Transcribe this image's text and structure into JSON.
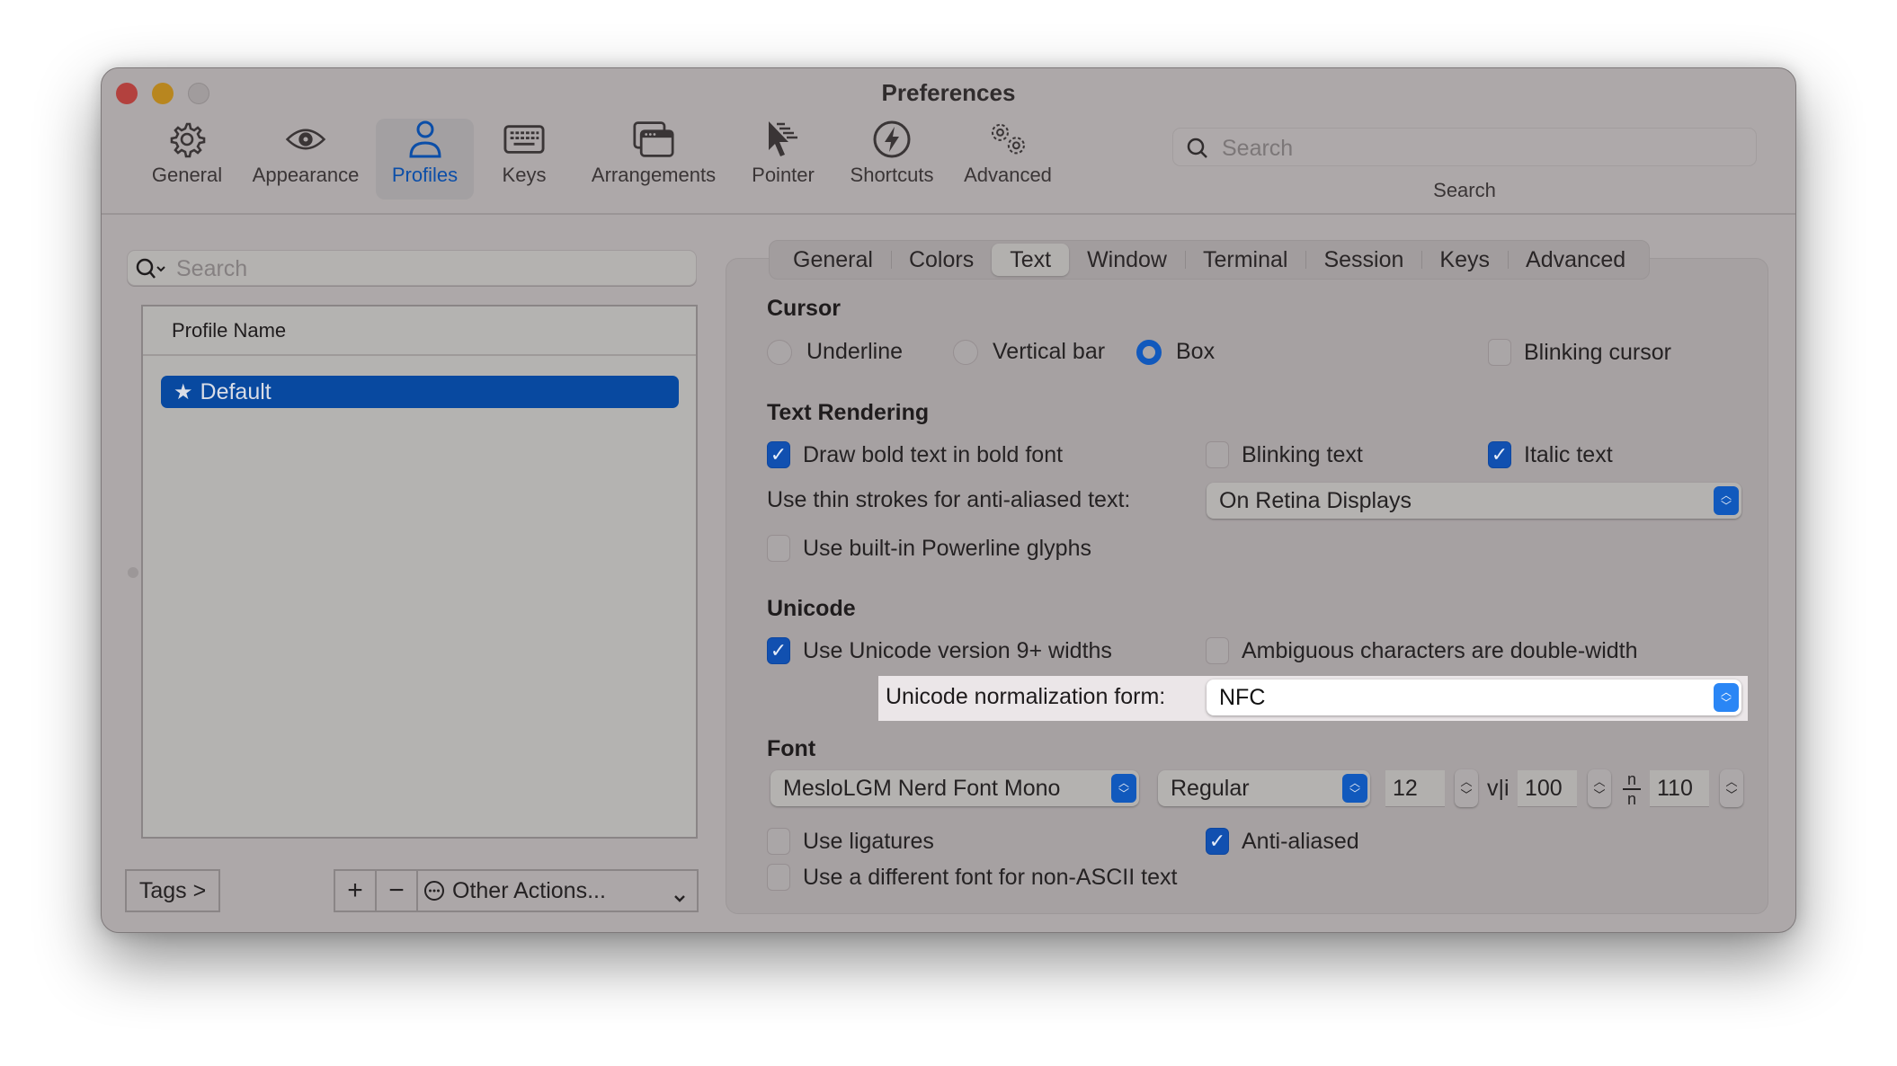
{
  "window": {
    "title": "Preferences",
    "traffic_lights": [
      "close",
      "minimize",
      "zoom"
    ]
  },
  "toolbar": {
    "items": [
      {
        "label": "General",
        "icon": "gear-icon",
        "active": false
      },
      {
        "label": "Appearance",
        "icon": "eye-icon",
        "active": false
      },
      {
        "label": "Profiles",
        "icon": "person-icon",
        "active": true
      },
      {
        "label": "Keys",
        "icon": "keyboard-icon",
        "active": false
      },
      {
        "label": "Arrangements",
        "icon": "windows-icon",
        "active": false
      },
      {
        "label": "Pointer",
        "icon": "pointer-icon",
        "active": false
      },
      {
        "label": "Shortcuts",
        "icon": "lightning-icon",
        "active": false
      },
      {
        "label": "Advanced",
        "icon": "gears-icon",
        "active": false
      }
    ],
    "search": {
      "placeholder": "Search",
      "label": "Search"
    }
  },
  "profiles": {
    "search_placeholder": "Search",
    "column_header": "Profile Name",
    "rows": [
      {
        "name": "Default",
        "is_default": true,
        "selected": true
      }
    ],
    "tags_button": "Tags >",
    "add_button": "+",
    "remove_button": "−",
    "other_actions": "Other Actions..."
  },
  "tabs": {
    "items": [
      "General",
      "Colors",
      "Text",
      "Window",
      "Terminal",
      "Session",
      "Keys",
      "Advanced"
    ],
    "active": "Text"
  },
  "cursor": {
    "title": "Cursor",
    "options": [
      {
        "label": "Underline",
        "selected": false
      },
      {
        "label": "Vertical bar",
        "selected": false
      },
      {
        "label": "Box",
        "selected": true
      }
    ],
    "blinking_cursor": {
      "label": "Blinking cursor",
      "checked": false
    }
  },
  "text_rendering": {
    "title": "Text Rendering",
    "bold": {
      "label": "Draw bold text in bold font",
      "checked": true
    },
    "blinking": {
      "label": "Blinking text",
      "checked": false
    },
    "italic": {
      "label": "Italic text",
      "checked": true
    },
    "thin_strokes_label": "Use thin strokes for anti-aliased text:",
    "thin_strokes_value": "On Retina Displays",
    "powerline": {
      "label": "Use built-in Powerline glyphs",
      "checked": false
    }
  },
  "unicode": {
    "title": "Unicode",
    "widths": {
      "label": "Use Unicode version 9+ widths",
      "checked": true
    },
    "ambiguous": {
      "label": "Ambiguous characters are double-width",
      "checked": false
    },
    "normalization_label": "Unicode normalization form:",
    "normalization_value": "NFC"
  },
  "font": {
    "title": "Font",
    "family": "MesloLGM Nerd Font Mono",
    "weight": "Regular",
    "size": "12",
    "horizontal_spacing_icon": "v|i",
    "horizontal_spacing": "100",
    "vertical_spacing": "110",
    "ligatures": {
      "label": "Use ligatures",
      "checked": false
    },
    "anti_aliased": {
      "label": "Anti-aliased",
      "checked": true
    },
    "non_ascii": {
      "label": "Use a different font for non-ASCII text",
      "checked": false
    }
  },
  "colors": {
    "accent": "#1159bd",
    "selection": "#0849a0",
    "spotlight": "#ebe6e8",
    "close": "#b3413e",
    "minimize": "#b8861f"
  }
}
